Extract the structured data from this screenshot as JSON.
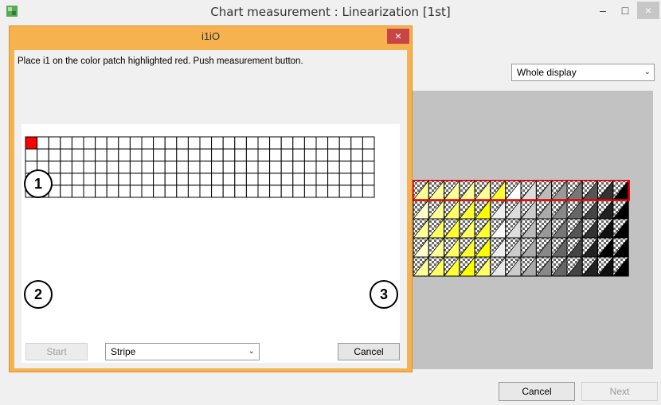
{
  "main_window": {
    "title": "Chart measurement : Linearization [1st]",
    "minimize_glyph": "–",
    "maximize_glyph": "□",
    "close_glyph": "×",
    "view_select": {
      "selected": "Whole display",
      "chevron": "⌄"
    },
    "buttons": {
      "cancel": "Cancel",
      "next": "Next"
    }
  },
  "dialog": {
    "title": "i1iO",
    "close_glyph": "×",
    "instruction": "Place i1 on the color patch highlighted red. Push measurement button.",
    "callouts": [
      "1",
      "2",
      "3"
    ],
    "buttons": {
      "start": "Start",
      "cancel": "Cancel"
    },
    "mode_select": {
      "selected": "Stripe",
      "chevron": "⌄"
    }
  },
  "icons": {
    "app": "app-icon",
    "minimize": "minimize-icon",
    "maximize": "maximize-icon",
    "close": "close-icon",
    "chevron": "chevron-down-icon"
  },
  "colors": {
    "dialog_frame": "#f5b24f",
    "dialog_close": "#c84545",
    "highlight": "#ff0000",
    "canvas_gray": "#c2c2c2"
  },
  "patch_grid": {
    "rows": 5,
    "columns": 30,
    "highlighted_cell": [
      0,
      0
    ]
  },
  "chart_preview": {
    "rows": 5,
    "columns": 14,
    "row_highlighted": 0,
    "row_colors": [
      [
        "#ffff99",
        "#ffff99",
        "#ffff99",
        "#ffff99",
        "#ffff99",
        "#ffff33",
        "#ffffff",
        "#dddddd",
        "#bbbbbb",
        "#999999",
        "#777777",
        "#555555",
        "#333333",
        "#000000"
      ],
      [
        "#ffffcc",
        "#ffff99",
        "#ffff66",
        "#ffff33",
        "#ffff00",
        "#eeeeee",
        "#dddddd",
        "#cccccc",
        "#aaaaaa",
        "#888888",
        "#666666",
        "#444444",
        "#222222",
        "#000000"
      ],
      [
        "#ffff99",
        "#ffff66",
        "#ffff33",
        "#ffff66",
        "#ffff33",
        "#f8f8f8",
        "#dddddd",
        "#bbbbbb",
        "#999999",
        "#777777",
        "#555555",
        "#333333",
        "#111111",
        "#000000"
      ],
      [
        "#ffffcc",
        "#ffff99",
        "#ffff66",
        "#ffff33",
        "#ffff00",
        "#eeeeee",
        "#cccccc",
        "#aaaaaa",
        "#888888",
        "#666666",
        "#444444",
        "#222222",
        "#000000",
        "#000000"
      ],
      [
        "#ffff99",
        "#ffff66",
        "#ffff33",
        "#ffff00",
        "#ffff66",
        "#e8e8e8",
        "#cccccc",
        "#aaaaaa",
        "#888888",
        "#666666",
        "#444444",
        "#222222",
        "#111111",
        "#000000"
      ]
    ]
  }
}
